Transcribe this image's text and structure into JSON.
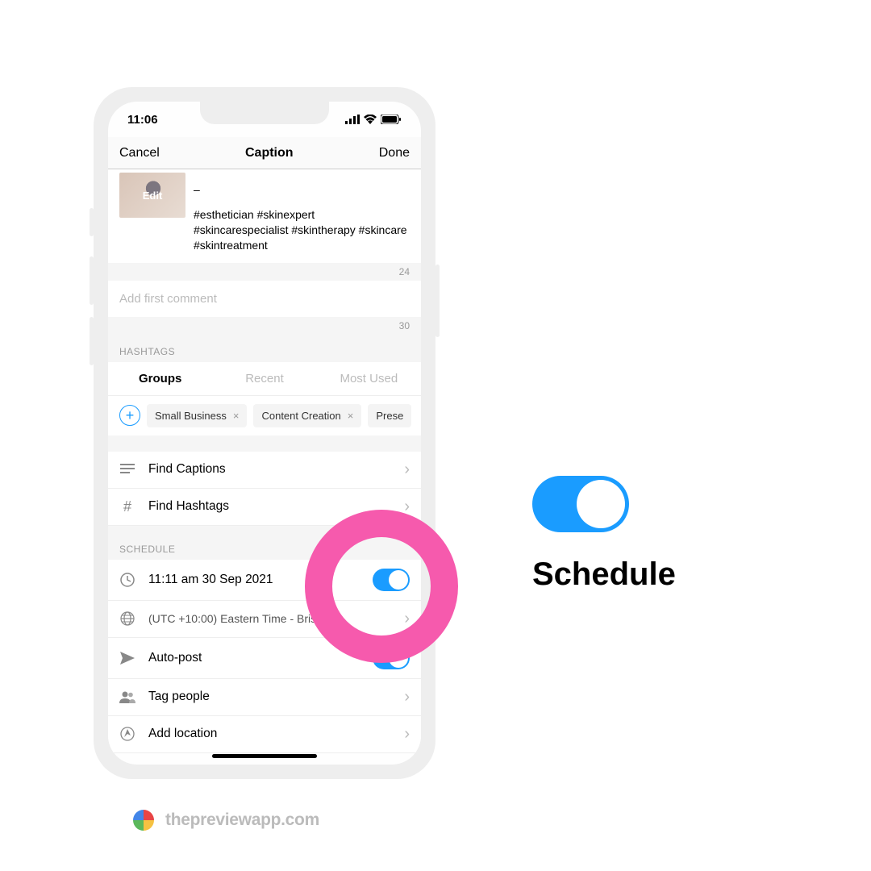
{
  "status": {
    "time": "11:06"
  },
  "nav": {
    "cancel": "Cancel",
    "title": "Caption",
    "done": "Done"
  },
  "caption": {
    "edit": "Edit",
    "dash": "–",
    "hashtags": " #esthetician #skinexpert #skincarespecialist #skintherapy #skincare #skintreatment",
    "count": "24"
  },
  "comment": {
    "placeholder": "Add first comment",
    "count": "30"
  },
  "hashtags_header": "HASHTAGS",
  "tabs": {
    "groups": "Groups",
    "recent": "Recent",
    "most_used": "Most Used"
  },
  "chips": [
    "Small Business",
    "Content Creation",
    "Prese"
  ],
  "rows": {
    "find_captions": "Find Captions",
    "find_hashtags": "Find Hashtags"
  },
  "schedule_header": "SCHEDULE",
  "schedule": {
    "time": "11:11 am  30 Sep 2021",
    "timezone": "(UTC +10:00) Eastern Time - Brisbane",
    "autopost": "Auto-post",
    "tag_people": "Tag people",
    "add_location": "Add location"
  },
  "side": {
    "label": "Schedule"
  },
  "footer": {
    "url": "thepreviewapp.com"
  }
}
